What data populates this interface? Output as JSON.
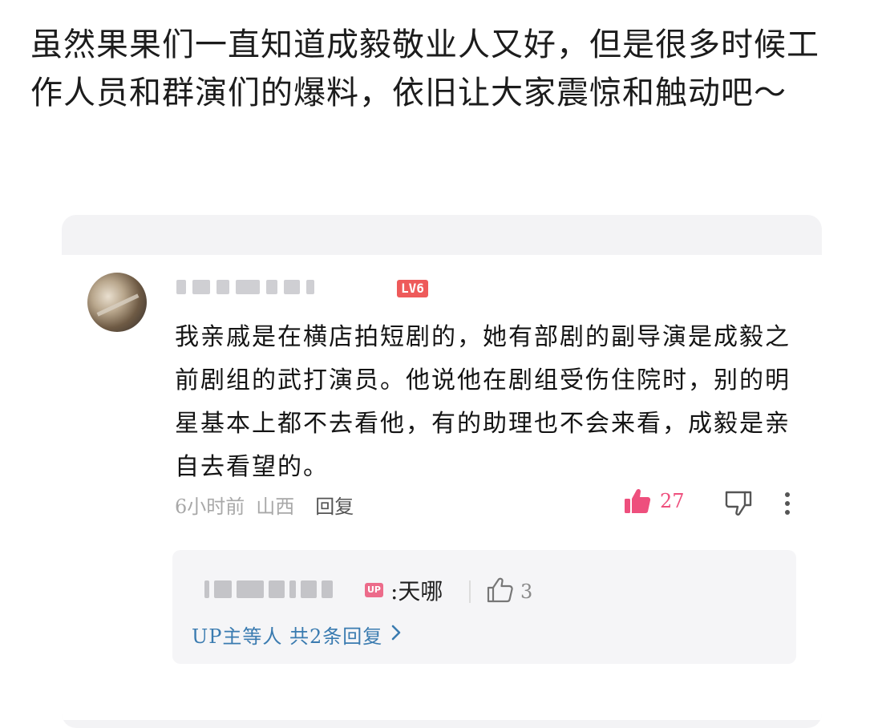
{
  "post": {
    "text": "虽然果果们一直知道成毅敬业人又好，但是很多时候工作人员和群演们的爆料，依旧让大家震惊和触动吧～"
  },
  "comment": {
    "level_badge": "LV6",
    "text": "我亲戚是在横店拍短剧的，她有部剧的副导演是成毅之前剧组的武打演员。他说他在剧组受伤住院时，别的明星基本上都不去看他，有的助理也不会来看，成毅是亲自去看望的。",
    "time": "6小时前",
    "location": "山西",
    "reply_label": "回复",
    "like_count": "27",
    "like_color": "#ee4f7d"
  },
  "reply": {
    "up_badge": "UP",
    "text": ":天哪",
    "like_count": "3",
    "more_replies": "UP主等人 共2条回复",
    "link_color": "#3a7bb0"
  },
  "icons": {
    "thumb_up": "thumb-up-icon",
    "thumb_down": "thumb-down-icon",
    "more": "more-vertical-icon",
    "chevron": "chevron-right-icon"
  }
}
